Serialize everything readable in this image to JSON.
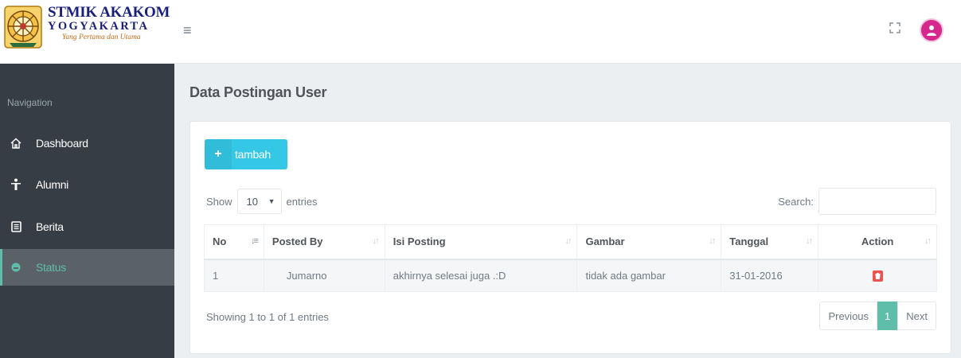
{
  "header": {
    "logo": {
      "line1": "STMIK AKAKOM",
      "line2": "YOGYAKARTA",
      "tagline": "Yang Pertama dan Utama"
    },
    "menu_icon": "≡",
    "fullscreen_icon": "expand-icon",
    "avatar_icon": "user-icon"
  },
  "sidebar": {
    "heading": "Navigation",
    "items": [
      {
        "label": "Dashboard",
        "icon": "home-icon",
        "active": false
      },
      {
        "label": "Alumni",
        "icon": "person-icon",
        "active": false
      },
      {
        "label": "Berita",
        "icon": "newspaper-icon",
        "active": false
      },
      {
        "label": "Status",
        "icon": "status-icon",
        "active": true
      }
    ]
  },
  "main": {
    "title": "Data Postingan User",
    "add_button": {
      "label": "tambah",
      "icon": "+"
    },
    "length": {
      "show": "Show",
      "value": "10",
      "entries": "entries"
    },
    "search": {
      "label": "Search:",
      "value": ""
    },
    "table": {
      "columns": [
        "No",
        "Posted By",
        "Isi Posting",
        "Gambar",
        "Tanggal",
        "Action"
      ],
      "rows": [
        {
          "no": "1",
          "posted_by": "Jumarno",
          "isi": "akhirnya selesai juga .:D",
          "gambar": "tidak ada gambar",
          "tanggal": "31-01-2016",
          "action": "delete-icon"
        }
      ]
    },
    "info": "Showing 1 to 1 of 1 entries",
    "pagination": {
      "previous": "Previous",
      "current": "1",
      "next": "Next"
    }
  },
  "colors": {
    "sidebar_bg": "#363d45",
    "accent": "#5fbeaa",
    "button": "#34c8e6",
    "danger": "#ef5350",
    "avatar": "#d6278c"
  }
}
